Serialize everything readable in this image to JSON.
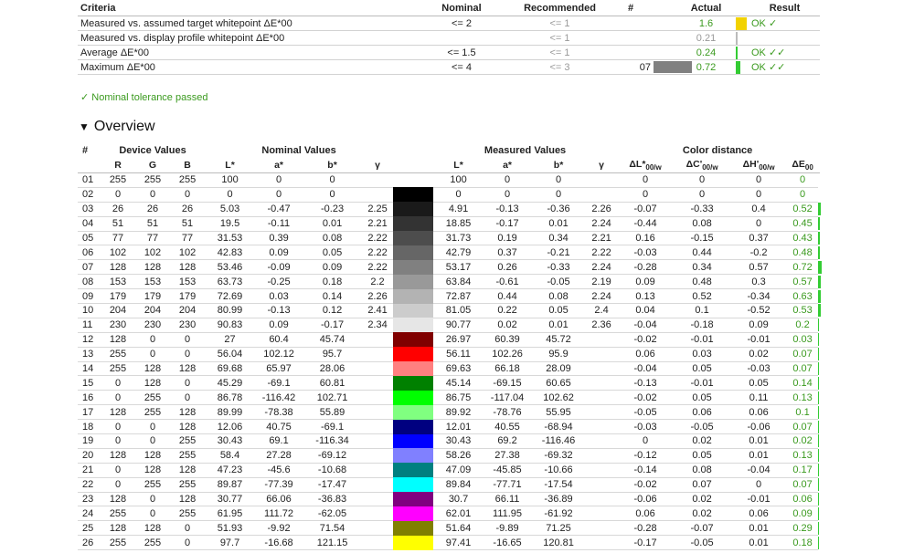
{
  "criteria": {
    "headers": {
      "criteria": "Criteria",
      "nominal": "Nominal",
      "recommended": "Recommended",
      "hash": "#",
      "actual": "Actual",
      "result": "Result"
    },
    "rows": [
      {
        "criteria": "Measured vs. assumed target whitepoint ΔE*00",
        "nominal": "<= 2",
        "recommended": "<= 1",
        "patch": "",
        "actual": "1.6",
        "actual_gray": false,
        "bar_color": "#f2d200",
        "bar_level": 0.8,
        "result": "OK ✓"
      },
      {
        "criteria": "Measured vs. display profile whitepoint ΔE*00",
        "nominal": "",
        "recommended": "<= 1",
        "patch": "",
        "actual": "0.21",
        "actual_gray": true,
        "bar_color": "#bbbbbb",
        "bar_level": 0.105,
        "result": ""
      },
      {
        "criteria": "Average ΔE*00",
        "nominal": "<= 1.5",
        "recommended": "<= 1",
        "patch": "",
        "actual": "0.24",
        "actual_gray": false,
        "bar_color": "#33cc33",
        "bar_level": 0.12,
        "result": "OK ✓✓"
      },
      {
        "criteria": "Maximum ΔE*00",
        "nominal": "<= 4",
        "recommended": "<= 3",
        "patch": "07",
        "patch_swatch": "#808080",
        "actual": "0.72",
        "actual_gray": false,
        "bar_color": "#33cc33",
        "bar_level": 0.36,
        "result": "OK ✓✓"
      }
    ]
  },
  "passed_text": "✓ Nominal tolerance passed",
  "overview": {
    "title": "Overview",
    "group_headers": {
      "num": "#",
      "device": "Device Values",
      "nominal": "Nominal Values",
      "measured": "Measured Values",
      "distance": "Color distance"
    },
    "col_headers": {
      "r": "R",
      "g": "G",
      "b": "B",
      "nl": "L*",
      "na": "a*",
      "nb": "b*",
      "ng": "γ",
      "ml": "L*",
      "ma": "a*",
      "mb": "b*",
      "mg": "γ"
    },
    "rows": [
      {
        "n": "01",
        "r": "255",
        "g": "255",
        "b": "255",
        "nl": "100",
        "na": "0",
        "nb": "0",
        "ng": "",
        "ml": "100",
        "ma": "0",
        "mb": "0",
        "mg": "",
        "dl": "0",
        "dc": "0",
        "dh": "0",
        "de": "0",
        "color": "#ffffff"
      },
      {
        "n": "02",
        "r": "0",
        "g": "0",
        "b": "0",
        "nl": "0",
        "na": "0",
        "nb": "0",
        "ng": "",
        "ml": "0",
        "ma": "0",
        "mb": "0",
        "mg": "",
        "dl": "0",
        "dc": "0",
        "dh": "0",
        "de": "0",
        "color": "#000000"
      },
      {
        "n": "03",
        "r": "26",
        "g": "26",
        "b": "26",
        "nl": "5.03",
        "na": "-0.47",
        "nb": "-0.23",
        "ng": "2.25",
        "ml": "4.91",
        "ma": "-0.13",
        "mb": "-0.36",
        "mg": "2.26",
        "dl": "-0.07",
        "dc": "-0.33",
        "dh": "0.4",
        "de": "0.52",
        "color": "#1a1a1a"
      },
      {
        "n": "04",
        "r": "51",
        "g": "51",
        "b": "51",
        "nl": "19.5",
        "na": "-0.11",
        "nb": "0.01",
        "ng": "2.21",
        "ml": "18.85",
        "ma": "-0.17",
        "mb": "0.01",
        "mg": "2.24",
        "dl": "-0.44",
        "dc": "0.08",
        "dh": "0",
        "de": "0.45",
        "color": "#333333"
      },
      {
        "n": "05",
        "r": "77",
        "g": "77",
        "b": "77",
        "nl": "31.53",
        "na": "0.39",
        "nb": "0.08",
        "ng": "2.22",
        "ml": "31.73",
        "ma": "0.19",
        "mb": "0.34",
        "mg": "2.21",
        "dl": "0.16",
        "dc": "-0.15",
        "dh": "0.37",
        "de": "0.43",
        "color": "#4d4d4d"
      },
      {
        "n": "06",
        "r": "102",
        "g": "102",
        "b": "102",
        "nl": "42.83",
        "na": "0.09",
        "nb": "0.05",
        "ng": "2.22",
        "ml": "42.79",
        "ma": "0.37",
        "mb": "-0.21",
        "mg": "2.22",
        "dl": "-0.03",
        "dc": "0.44",
        "dh": "-0.2",
        "de": "0.48",
        "color": "#666666"
      },
      {
        "n": "07",
        "r": "128",
        "g": "128",
        "b": "128",
        "nl": "53.46",
        "na": "-0.09",
        "nb": "0.09",
        "ng": "2.22",
        "ml": "53.17",
        "ma": "0.26",
        "mb": "-0.33",
        "mg": "2.24",
        "dl": "-0.28",
        "dc": "0.34",
        "dh": "0.57",
        "de": "0.72",
        "color": "#808080"
      },
      {
        "n": "08",
        "r": "153",
        "g": "153",
        "b": "153",
        "nl": "63.73",
        "na": "-0.25",
        "nb": "0.18",
        "ng": "2.2",
        "ml": "63.84",
        "ma": "-0.61",
        "mb": "-0.05",
        "mg": "2.19",
        "dl": "0.09",
        "dc": "0.48",
        "dh": "0.3",
        "de": "0.57",
        "color": "#999999"
      },
      {
        "n": "09",
        "r": "179",
        "g": "179",
        "b": "179",
        "nl": "72.69",
        "na": "0.03",
        "nb": "0.14",
        "ng": "2.26",
        "ml": "72.87",
        "ma": "0.44",
        "mb": "0.08",
        "mg": "2.24",
        "dl": "0.13",
        "dc": "0.52",
        "dh": "-0.34",
        "de": "0.63",
        "color": "#b3b3b3"
      },
      {
        "n": "10",
        "r": "204",
        "g": "204",
        "b": "204",
        "nl": "80.99",
        "na": "-0.13",
        "nb": "0.12",
        "ng": "2.41",
        "ml": "81.05",
        "ma": "0.22",
        "mb": "0.05",
        "mg": "2.4",
        "dl": "0.04",
        "dc": "0.1",
        "dh": "-0.52",
        "de": "0.53",
        "color": "#cccccc"
      },
      {
        "n": "11",
        "r": "230",
        "g": "230",
        "b": "230",
        "nl": "90.83",
        "na": "0.09",
        "nb": "-0.17",
        "ng": "2.34",
        "ml": "90.77",
        "ma": "0.02",
        "mb": "0.01",
        "mg": "2.36",
        "dl": "-0.04",
        "dc": "-0.18",
        "dh": "0.09",
        "de": "0.2",
        "color": "#e6e6e6"
      },
      {
        "n": "12",
        "r": "128",
        "g": "0",
        "b": "0",
        "nl": "27",
        "na": "60.4",
        "nb": "45.74",
        "ng": "",
        "ml": "26.97",
        "ma": "60.39",
        "mb": "45.72",
        "mg": "",
        "dl": "-0.02",
        "dc": "-0.01",
        "dh": "-0.01",
        "de": "0.03",
        "color": "#800000"
      },
      {
        "n": "13",
        "r": "255",
        "g": "0",
        "b": "0",
        "nl": "56.04",
        "na": "102.12",
        "nb": "95.7",
        "ng": "",
        "ml": "56.11",
        "ma": "102.26",
        "mb": "95.9",
        "mg": "",
        "dl": "0.06",
        "dc": "0.03",
        "dh": "0.02",
        "de": "0.07",
        "color": "#ff0000"
      },
      {
        "n": "14",
        "r": "255",
        "g": "128",
        "b": "128",
        "nl": "69.68",
        "na": "65.97",
        "nb": "28.06",
        "ng": "",
        "ml": "69.63",
        "ma": "66.18",
        "mb": "28.09",
        "mg": "",
        "dl": "-0.04",
        "dc": "0.05",
        "dh": "-0.03",
        "de": "0.07",
        "color": "#ff8080"
      },
      {
        "n": "15",
        "r": "0",
        "g": "128",
        "b": "0",
        "nl": "45.29",
        "na": "-69.1",
        "nb": "60.81",
        "ng": "",
        "ml": "45.14",
        "ma": "-69.15",
        "mb": "60.65",
        "mg": "",
        "dl": "-0.13",
        "dc": "-0.01",
        "dh": "0.05",
        "de": "0.14",
        "color": "#008000"
      },
      {
        "n": "16",
        "r": "0",
        "g": "255",
        "b": "0",
        "nl": "86.78",
        "na": "-116.42",
        "nb": "102.71",
        "ng": "",
        "ml": "86.75",
        "ma": "-117.04",
        "mb": "102.62",
        "mg": "",
        "dl": "-0.02",
        "dc": "0.05",
        "dh": "0.11",
        "de": "0.13",
        "color": "#00ff00"
      },
      {
        "n": "17",
        "r": "128",
        "g": "255",
        "b": "128",
        "nl": "89.99",
        "na": "-78.38",
        "nb": "55.89",
        "ng": "",
        "ml": "89.92",
        "ma": "-78.76",
        "mb": "55.95",
        "mg": "",
        "dl": "-0.05",
        "dc": "0.06",
        "dh": "0.06",
        "de": "0.1",
        "color": "#80ff80"
      },
      {
        "n": "18",
        "r": "0",
        "g": "0",
        "b": "128",
        "nl": "12.06",
        "na": "40.75",
        "nb": "-69.1",
        "ng": "",
        "ml": "12.01",
        "ma": "40.55",
        "mb": "-68.94",
        "mg": "",
        "dl": "-0.03",
        "dc": "-0.05",
        "dh": "-0.06",
        "de": "0.07",
        "color": "#000080"
      },
      {
        "n": "19",
        "r": "0",
        "g": "0",
        "b": "255",
        "nl": "30.43",
        "na": "69.1",
        "nb": "-116.34",
        "ng": "",
        "ml": "30.43",
        "ma": "69.2",
        "mb": "-116.46",
        "mg": "",
        "dl": "0",
        "dc": "0.02",
        "dh": "0.01",
        "de": "0.02",
        "color": "#0000ff"
      },
      {
        "n": "20",
        "r": "128",
        "g": "128",
        "b": "255",
        "nl": "58.4",
        "na": "27.28",
        "nb": "-69.12",
        "ng": "",
        "ml": "58.26",
        "ma": "27.38",
        "mb": "-69.32",
        "mg": "",
        "dl": "-0.12",
        "dc": "0.05",
        "dh": "0.01",
        "de": "0.13",
        "color": "#8080ff"
      },
      {
        "n": "21",
        "r": "0",
        "g": "128",
        "b": "128",
        "nl": "47.23",
        "na": "-45.6",
        "nb": "-10.68",
        "ng": "",
        "ml": "47.09",
        "ma": "-45.85",
        "mb": "-10.66",
        "mg": "",
        "dl": "-0.14",
        "dc": "0.08",
        "dh": "-0.04",
        "de": "0.17",
        "color": "#008080"
      },
      {
        "n": "22",
        "r": "0",
        "g": "255",
        "b": "255",
        "nl": "89.87",
        "na": "-77.39",
        "nb": "-17.47",
        "ng": "",
        "ml": "89.84",
        "ma": "-77.71",
        "mb": "-17.54",
        "mg": "",
        "dl": "-0.02",
        "dc": "0.07",
        "dh": "0",
        "de": "0.07",
        "color": "#00ffff"
      },
      {
        "n": "23",
        "r": "128",
        "g": "0",
        "b": "128",
        "nl": "30.77",
        "na": "66.06",
        "nb": "-36.83",
        "ng": "",
        "ml": "30.7",
        "ma": "66.11",
        "mb": "-36.89",
        "mg": "",
        "dl": "-0.06",
        "dc": "0.02",
        "dh": "-0.01",
        "de": "0.06",
        "color": "#800080"
      },
      {
        "n": "24",
        "r": "255",
        "g": "0",
        "b": "255",
        "nl": "61.95",
        "na": "111.72",
        "nb": "-62.05",
        "ng": "",
        "ml": "62.01",
        "ma": "111.95",
        "mb": "-61.92",
        "mg": "",
        "dl": "0.06",
        "dc": "0.02",
        "dh": "0.06",
        "de": "0.09",
        "color": "#ff00ff"
      },
      {
        "n": "25",
        "r": "128",
        "g": "128",
        "b": "0",
        "nl": "51.93",
        "na": "-9.92",
        "nb": "71.54",
        "ng": "",
        "ml": "51.64",
        "ma": "-9.89",
        "mb": "71.25",
        "mg": "",
        "dl": "-0.28",
        "dc": "-0.07",
        "dh": "0.01",
        "de": "0.29",
        "color": "#808000"
      },
      {
        "n": "26",
        "r": "255",
        "g": "255",
        "b": "0",
        "nl": "97.7",
        "na": "-16.68",
        "nb": "121.15",
        "ng": "",
        "ml": "97.41",
        "ma": "-16.65",
        "mb": "120.81",
        "mg": "",
        "dl": "-0.17",
        "dc": "-0.05",
        "dh": "0.01",
        "de": "0.18",
        "color": "#ffff00"
      }
    ]
  }
}
